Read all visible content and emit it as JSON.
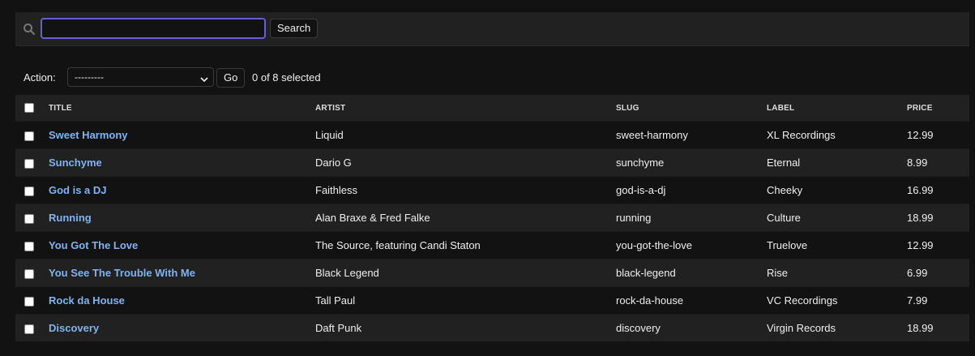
{
  "search": {
    "value": "",
    "placeholder": "",
    "button_label": "Search"
  },
  "actions": {
    "label": "Action:",
    "selected_option": "---------",
    "go_label": "Go",
    "counter": "0 of 8 selected"
  },
  "table": {
    "headers": {
      "title": "Title",
      "artist": "Artist",
      "slug": "Slug",
      "label": "Label",
      "price": "Price"
    },
    "rows": [
      {
        "title": "Sweet Harmony",
        "artist": "Liquid",
        "slug": "sweet-harmony",
        "label": "XL Recordings",
        "price": "12.99"
      },
      {
        "title": "Sunchyme",
        "artist": "Dario G",
        "slug": "sunchyme",
        "label": "Eternal",
        "price": "8.99"
      },
      {
        "title": "God is a DJ",
        "artist": "Faithless",
        "slug": "god-is-a-dj",
        "label": "Cheeky",
        "price": "16.99"
      },
      {
        "title": "Running",
        "artist": "Alan Braxe & Fred Falke",
        "slug": "running",
        "label": "Culture",
        "price": "18.99"
      },
      {
        "title": "You Got The Love",
        "artist": "The Source, featuring Candi Staton",
        "slug": "you-got-the-love",
        "label": "Truelove",
        "price": "12.99"
      },
      {
        "title": "You See The Trouble With Me",
        "artist": "Black Legend",
        "slug": "black-legend",
        "label": "Rise",
        "price": "6.99"
      },
      {
        "title": "Rock da House",
        "artist": "Tall Paul",
        "slug": "rock-da-house",
        "label": "VC Recordings",
        "price": "7.99"
      },
      {
        "title": "Discovery",
        "artist": "Daft Punk",
        "slug": "discovery",
        "label": "Virgin Records",
        "price": "18.99"
      }
    ]
  },
  "colors": {
    "background": "#121212",
    "surface": "#212121",
    "link": "#81b3f0",
    "focus_border": "#6b5bd6"
  }
}
